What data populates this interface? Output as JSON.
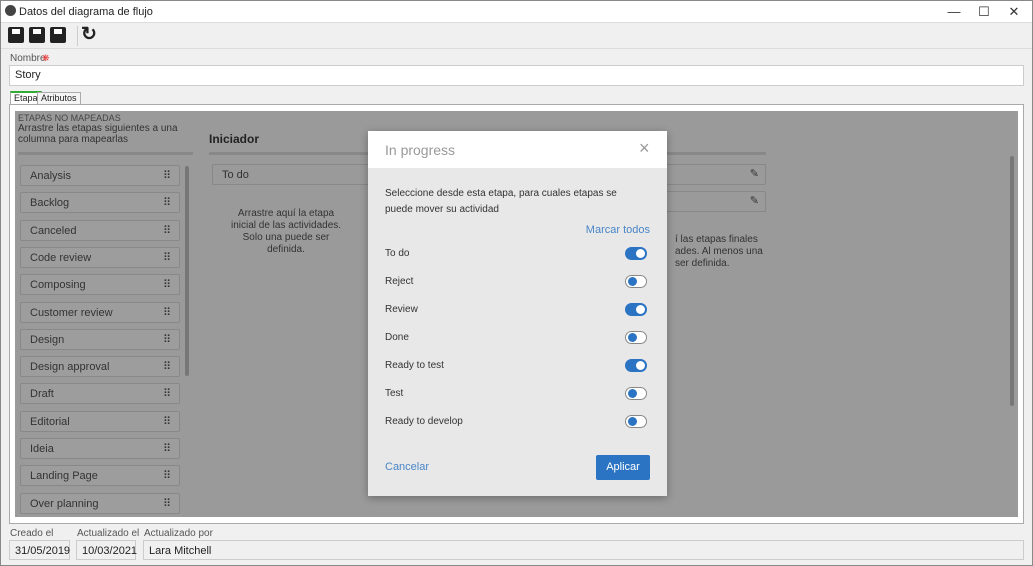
{
  "window": {
    "title": "Datos del diagrama de flujo",
    "minimize": "—",
    "maximize": "☐",
    "close": "✕"
  },
  "toolbar": {
    "icons": [
      "save-new-icon",
      "save-icon",
      "save-close-icon",
      "refresh-icon"
    ],
    "refresh": "↻"
  },
  "name_field": {
    "label": "Nombre",
    "required_mark": "❋",
    "value": "Story"
  },
  "tabs": [
    {
      "label": "Etapa",
      "active": true
    },
    {
      "label": "Atributos",
      "active": false
    }
  ],
  "unmapped": {
    "heading": "ETAPAS NO MAPEADAS",
    "hint": "Arrastre las etapas siguientes a una columna para mapearlas",
    "items": [
      "Analysis",
      "Backlog",
      "Canceled",
      "Code review",
      "Composing",
      "Customer review",
      "Design",
      "Design approval",
      "Draft",
      "Editorial",
      "Ideia",
      "Landing Page",
      "Over planning"
    ]
  },
  "initiator": {
    "title": "Iniciador",
    "items": [
      "To do"
    ],
    "hint": "Arrastre aquí la etapa inicial de las actividades. Solo una puede ser definida."
  },
  "final_col": {
    "hint_lines": [
      "í las etapas finales",
      "ades. Al menos una",
      "ser definida."
    ]
  },
  "modal": {
    "title": "In progress",
    "close": "×",
    "description": "Seleccione desde esta etapa, para cuales etapas se puede mover su actividad",
    "mark_all": "Marcar todos",
    "options": [
      {
        "label": "To do",
        "on": true
      },
      {
        "label": "Reject",
        "on": false
      },
      {
        "label": "Review",
        "on": true
      },
      {
        "label": "Done",
        "on": false
      },
      {
        "label": "Ready to test",
        "on": true
      },
      {
        "label": "Test",
        "on": false
      },
      {
        "label": "Ready to develop",
        "on": false
      }
    ],
    "cancel": "Cancelar",
    "apply": "Aplicar",
    "accent": "#2b74c3"
  },
  "footer": {
    "created_label": "Creado el",
    "created": "31/05/2019",
    "updated_label": "Actualizado el",
    "updated": "10/03/2021",
    "updated_by_label": "Actualizado por",
    "updated_by": "Lara Mitchell"
  },
  "grip": "⠿",
  "pencil": "✎"
}
